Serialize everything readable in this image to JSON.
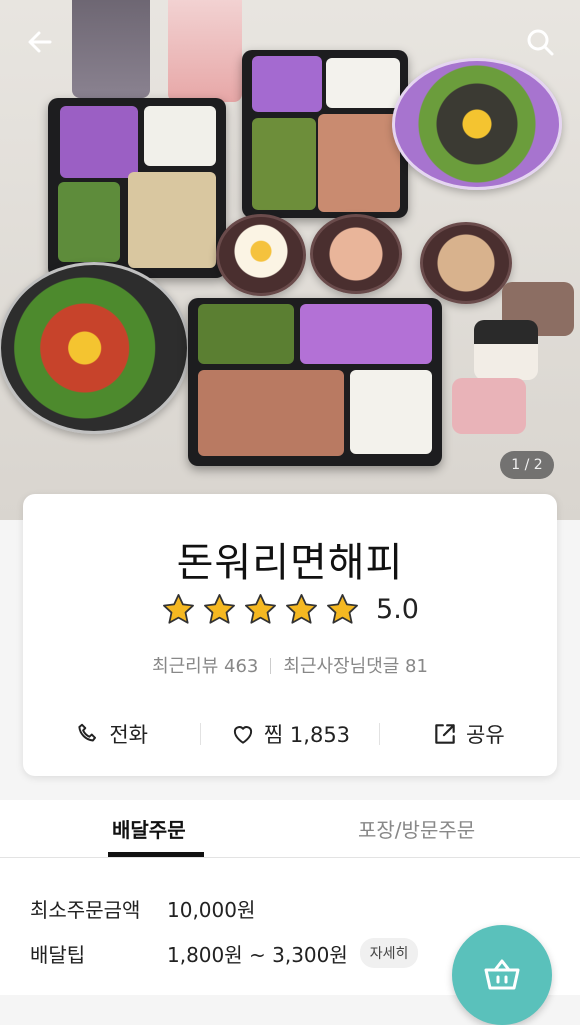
{
  "header": {
    "back_icon": "arrow-left-icon",
    "search_icon": "search-icon",
    "page_indicator": "1 / 2"
  },
  "store": {
    "name": "돈워리면해피",
    "rating_value": "5.0",
    "stars": 5,
    "recent_reviews_label": "최근리뷰 463",
    "owner_replies_label": "최근사장님댓글 81"
  },
  "actions": {
    "call_label": "전화",
    "like_label": "찜 1,853",
    "share_label": "공유"
  },
  "tabs": {
    "delivery": "배달주문",
    "pickup": "포장/방문주문"
  },
  "info": {
    "min_order_label": "최소주문금액",
    "min_order_value": "10,000원",
    "delivery_tip_label": "배달팁",
    "delivery_tip_value": "1,800원 ~ 3,300원",
    "detail_button": "자세히"
  },
  "colors": {
    "accent": "#5ac1bb",
    "star": "#f5b821"
  }
}
